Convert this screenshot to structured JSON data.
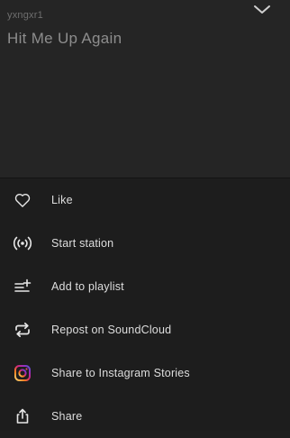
{
  "player": {
    "artist": "yxngxr1",
    "title": "Hit Me Up Again",
    "collapse_icon": "chevron-down-icon"
  },
  "menu": {
    "items": [
      {
        "label": "Like",
        "icon": "heart-icon"
      },
      {
        "label": "Start station",
        "icon": "station-icon"
      },
      {
        "label": "Add to playlist",
        "icon": "playlist-add-icon"
      },
      {
        "label": "Repost on SoundCloud",
        "icon": "repost-icon"
      },
      {
        "label": "Share to Instagram Stories",
        "icon": "instagram-icon"
      },
      {
        "label": "Share",
        "icon": "share-icon"
      }
    ]
  },
  "colors": {
    "background": "#1e1e1e",
    "header_background": "#252525",
    "text": "#dedede",
    "muted_text": "#6f6f6f",
    "instagram_gradient": [
      "#feda75",
      "#fa7e1e",
      "#d62976",
      "#962fbf",
      "#4f5bd5"
    ]
  }
}
